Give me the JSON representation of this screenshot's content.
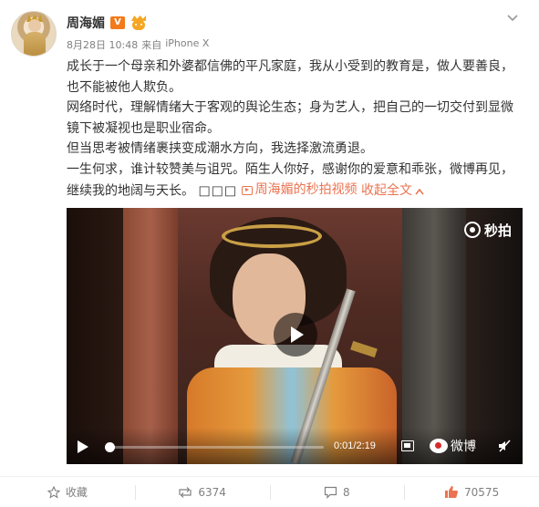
{
  "post": {
    "author": "周海媚",
    "vip_badge": "V",
    "timestamp": "8月28日 10:48",
    "via_label": "来自",
    "device": "iPhone X",
    "paragraphs": [
      "成长于一个母亲和外婆都信佛的平凡家庭，我从小受到的教育是，做人要善良，也不能被他人欺负。",
      "网络时代，理解情绪大于客观的舆论生态；身为艺人，把自己的一切交付到显微镜下被凝视也是职业宿命。",
      "但当思考被情绪裹挟变成潮水方向，我选择激流勇退。",
      "一生何求，谁计较赞美与诅咒。陌生人你好，感谢你的爱意和乖张，微博再见，继续我的地阔与天长。"
    ],
    "boxes": "□□□",
    "video_link": "周海媚的秒拍视频",
    "collapse_label": "收起全文"
  },
  "video": {
    "logo_text": "秒拍",
    "time": "0:01/2:19",
    "progress": 0.01,
    "weibo_text": "微博"
  },
  "actions": {
    "favorite": "收藏",
    "repost": "6374",
    "comment": "8",
    "like": "70575"
  },
  "colors": {
    "accent": "#eb7350",
    "vip": "#f27a1a",
    "text": "#333333",
    "meta": "#808080"
  }
}
